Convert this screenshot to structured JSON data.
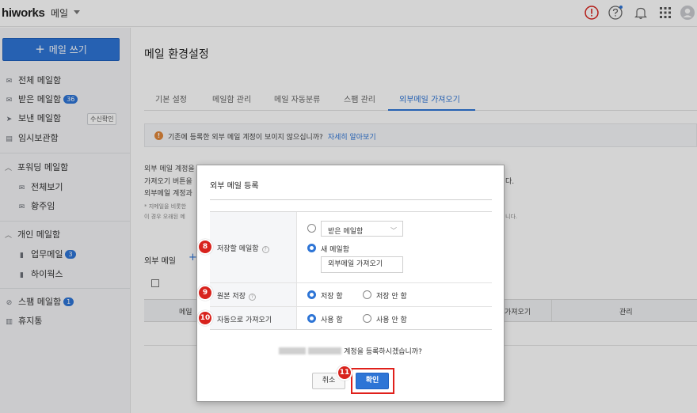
{
  "header": {
    "logo": "hiworks",
    "app_name": "메일"
  },
  "sidebar": {
    "compose_label": "메일 쓰기",
    "mailboxes": [
      {
        "label": "전체 메일함"
      },
      {
        "label": "받은 메일함",
        "count": "36"
      },
      {
        "label": "보낸 메일함",
        "action": "수신확인"
      },
      {
        "label": "임시보관함"
      }
    ],
    "forward_group": {
      "label": "포워딩 메일함",
      "items": [
        {
          "label": "전체보기"
        },
        {
          "label": "황주임"
        }
      ]
    },
    "personal_group": {
      "label": "개인 메일함",
      "items": [
        {
          "label": "업무메일",
          "count": "3"
        },
        {
          "label": "하이웍스"
        }
      ]
    },
    "spam": {
      "label": "스팸 메일함",
      "count": "1"
    },
    "trash": {
      "label": "휴지통"
    }
  },
  "main": {
    "title": "메일 환경설정",
    "tabs": [
      {
        "label": "기본 설정"
      },
      {
        "label": "메일함 관리"
      },
      {
        "label": "메일 자동분류"
      },
      {
        "label": "스팸 관리"
      },
      {
        "label": "외부메일 가져오기"
      }
    ],
    "notice": {
      "text": "기존에 등록한 외부 메일 계정이 보이지 않으십니까?",
      "link": "자세히 알아보기"
    },
    "desc_lines": [
      "외부 메일 계정을",
      "가져오기 버튼을",
      "외부메일 계정과"
    ],
    "desc_right": "다.",
    "small_lines": [
      "* 지메일을 비롯한",
      "  이 경우 오래된 메"
    ],
    "small_right": "니다.",
    "ext_label": "외부 메일",
    "table": {
      "col_mail": "메일",
      "col_fetch": "가져오기",
      "col_manage": "관리"
    }
  },
  "modal": {
    "title": "외부 메일 등록",
    "rows": {
      "save_mailbox": {
        "label": "저장할 메일함",
        "options": {
          "existing": "받은 메일함",
          "new": "새 메일함"
        },
        "new_name": "외부메일 가져오기",
        "selected": "new"
      },
      "keep_original": {
        "label": "원본 저장",
        "on": "저장 함",
        "off": "저장 안 함",
        "selected": "on"
      },
      "auto_fetch": {
        "label": "자동으로 가져오기",
        "on": "사용 함",
        "off": "사용 안 함",
        "selected": "on"
      }
    },
    "question": "계정을 등록하시겠습니까?",
    "cancel": "취소",
    "confirm": "확인"
  },
  "steps": {
    "s8": "8",
    "s9": "9",
    "s10": "10",
    "s11": "11"
  },
  "colors": {
    "accent": "#2e75d6",
    "step_badge": "#d8231d",
    "highlight": "#e0201b"
  }
}
